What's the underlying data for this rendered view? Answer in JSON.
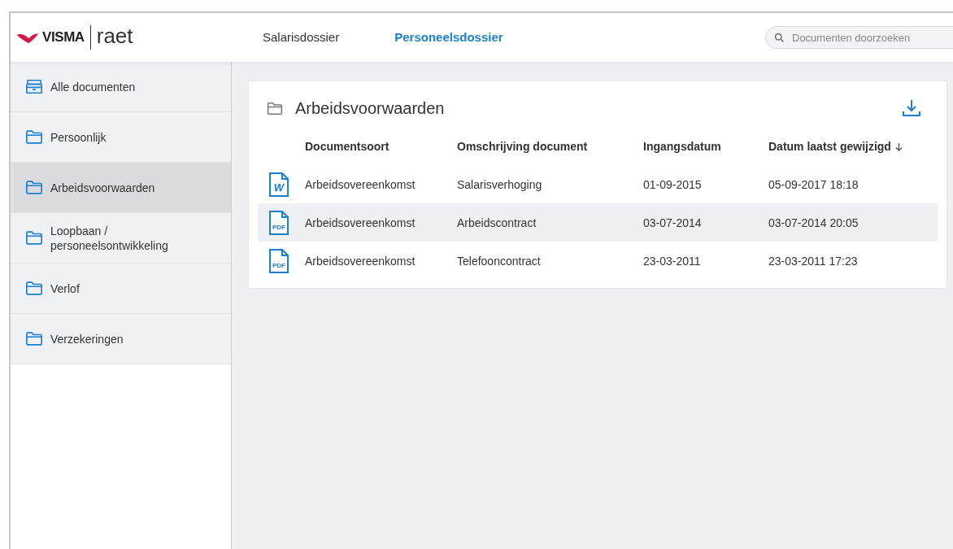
{
  "logo": {
    "brand": "VISMA",
    "product": "raet"
  },
  "nav_tabs": [
    {
      "label": "Salarisdossier",
      "selected": false
    },
    {
      "label": "Personeelsdossier",
      "selected": true
    }
  ],
  "search": {
    "placeholder": "Documenten doorzoeken"
  },
  "sidebar": {
    "items": [
      {
        "label": "Alle documenten",
        "kind": "archive",
        "selected": false
      },
      {
        "label": "Persoonlijk",
        "kind": "folder",
        "selected": false
      },
      {
        "label": "Arbeidsvoorwaarden",
        "kind": "folder",
        "selected": true
      },
      {
        "label": "Loopbaan / personeelsontwikkeling",
        "kind": "folder",
        "selected": false
      },
      {
        "label": "Verlof",
        "kind": "folder",
        "selected": false
      },
      {
        "label": "Verzekeringen",
        "kind": "folder",
        "selected": false
      }
    ]
  },
  "panel": {
    "title": "Arbeidsvoorwaarden",
    "table": {
      "columns": [
        {
          "label": "Documentsoort",
          "sorted": false
        },
        {
          "label": "Omschrijving document",
          "sorted": false
        },
        {
          "label": "Ingangsdatum",
          "sorted": false
        },
        {
          "label": "Datum laatst gewijzigd",
          "sorted": true
        }
      ],
      "rows": [
        {
          "kind": "word",
          "file_label": "W",
          "selected": false,
          "cells": [
            "Arbeidsovereenkomst",
            "Salarisverhoging",
            "01-09-2015",
            "05-09-2017 18:18"
          ]
        },
        {
          "kind": "pdf",
          "file_label": "PDF",
          "selected": true,
          "cells": [
            "Arbeidsovereenkomst",
            "Arbeidscontract",
            "03-07-2014",
            "03-07-2014 20:05"
          ]
        },
        {
          "kind": "pdf",
          "file_label": "PDF",
          "selected": false,
          "cells": [
            "Arbeidsovereenkomst",
            "Telefooncontract",
            "23-03-2011",
            "23-03-2011 17:23"
          ]
        }
      ]
    }
  }
}
